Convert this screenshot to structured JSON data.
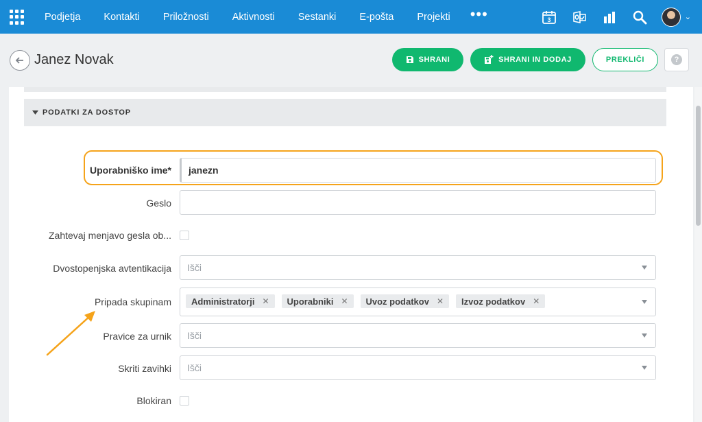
{
  "nav": {
    "items": [
      "Podjetja",
      "Kontakti",
      "Priložnosti",
      "Aktivnosti",
      "Sestanki",
      "E-pošta",
      "Projekti"
    ],
    "more": "•••",
    "calendar_day": "3",
    "icons": [
      "apps-grid-icon",
      "calendar-icon",
      "outlook-icon",
      "stats-icon",
      "search-icon",
      "avatar",
      "chevron-down-icon"
    ]
  },
  "header": {
    "title": "Janez Novak",
    "save_label": "SHRANI",
    "save_add_label": "SHRANI IN DODAJ",
    "cancel_label": "PREKLIČI",
    "help_label": "?"
  },
  "section": {
    "title": "PODATKI ZA DOSTOP"
  },
  "form": {
    "username_label": "Uporabniško ime*",
    "username_value": "janezn",
    "password_label": "Geslo",
    "password_value": "",
    "require_change_label": "Zahtevaj menjavo gesla ob...",
    "two_factor_label": "Dvostopenjska avtentikacija",
    "two_factor_placeholder": "Išči",
    "groups_label": "Pripada skupinam",
    "groups": [
      "Administratorji",
      "Uporabniki",
      "Uvoz podatkov",
      "Izvoz podatkov"
    ],
    "schedule_label": "Pravice za urnik",
    "schedule_placeholder": "Išči",
    "hidden_tabs_label": "Skriti zavihki",
    "hidden_tabs_placeholder": "Išči",
    "blocked_label": "Blokiran"
  },
  "colors": {
    "nav_bg": "#1a8bd6",
    "accent_green": "#10b86f",
    "highlight_orange": "#f5a31a"
  }
}
